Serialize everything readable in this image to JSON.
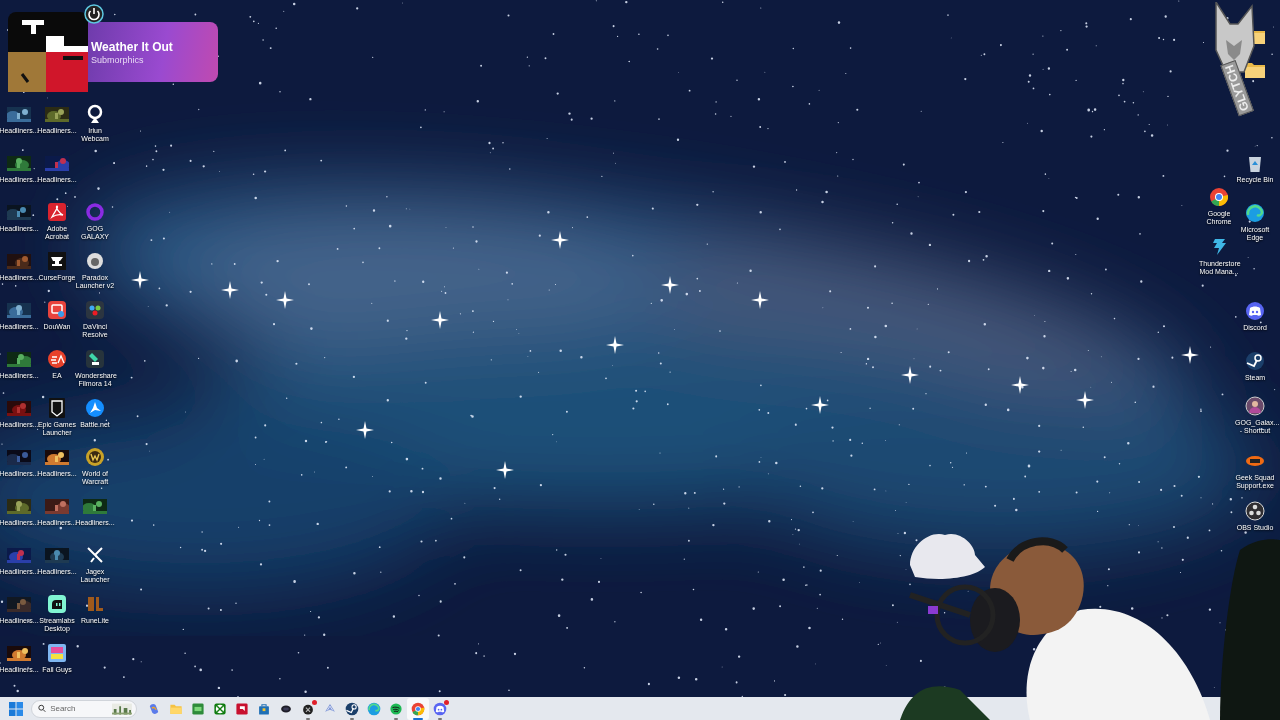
{
  "now_playing": {
    "title": "Weather It Out",
    "artist": "Submorphics"
  },
  "desktop_left": [
    [
      {
        "kind": "thumbnail",
        "label": "Headliners..."
      },
      {
        "kind": "thumbnail",
        "label": "Headliners..."
      },
      {
        "kind": "webcam",
        "label": "Iriun Webcam"
      }
    ],
    [
      {
        "kind": "thumbnail",
        "label": "Headliners..."
      },
      {
        "kind": "thumbnail",
        "label": "Headliners..."
      }
    ],
    [
      {
        "kind": "thumbnail",
        "label": "Headliners..."
      },
      {
        "kind": "pdf",
        "label": "Adobe Acrobat"
      },
      {
        "kind": "ring",
        "label": "GOG GALAXY"
      }
    ],
    [
      {
        "kind": "thumbnail",
        "label": "Headliners..."
      },
      {
        "kind": "anvil",
        "label": "CurseForge"
      },
      {
        "kind": "lion",
        "label": "Paradox Launcher v2"
      }
    ],
    [
      {
        "kind": "thumbnail",
        "label": "Headliners..."
      },
      {
        "kind": "screen",
        "label": "DouWan"
      },
      {
        "kind": "resolve",
        "label": "DaVinci Resolve"
      }
    ],
    [
      {
        "kind": "thumbnail",
        "label": "Headliners..."
      },
      {
        "kind": "ea",
        "label": "EA"
      },
      {
        "kind": "filmora",
        "label": "Wondershare Filmora 14"
      }
    ],
    [
      {
        "kind": "thumbnail",
        "label": "Headliners..."
      },
      {
        "kind": "epic",
        "label": "Epic Games Launcher"
      },
      {
        "kind": "battlenet",
        "label": "Battle.net"
      }
    ],
    [
      {
        "kind": "thumbnail",
        "label": "Headliners..."
      },
      {
        "kind": "thumbnail",
        "label": "Headliners..."
      },
      {
        "kind": "wow",
        "label": "World of Warcraft"
      }
    ],
    [
      {
        "kind": "thumbnail",
        "label": "Headliners..."
      },
      {
        "kind": "thumbnail",
        "label": "Headliners..."
      },
      {
        "kind": "thumbnail",
        "label": "Headliners..."
      }
    ],
    [
      {
        "kind": "thumbnail",
        "label": "Headliners..."
      },
      {
        "kind": "thumbnail",
        "label": "Headliners..."
      },
      {
        "kind": "jagex",
        "label": "Jagex Launcher"
      }
    ],
    [
      {
        "kind": "thumbnail",
        "label": "Headliners..."
      },
      {
        "kind": "streamlabs",
        "label": "Streamlabs Desktop"
      },
      {
        "kind": "runelite",
        "label": "RuneLite"
      }
    ],
    [
      {
        "kind": "thumbnail",
        "label": "Headliners..."
      },
      {
        "kind": "fallguys",
        "label": "Fall Guys"
      }
    ]
  ],
  "desktop_right": [
    {
      "kind": "recycle",
      "label": "Recycle Bin"
    },
    {
      "kind": "chrome",
      "label": "Google Chrome"
    },
    {
      "kind": "edge",
      "label": "Microsoft Edge"
    },
    {
      "kind": "thunderstore",
      "label": "Thunderstore Mod Mana..."
    },
    {
      "kind": "discord",
      "label": "Discord"
    },
    {
      "kind": "steam",
      "label": "Steam"
    },
    {
      "kind": "avatar",
      "label": "GOG_Galax... - Shortcut"
    },
    {
      "kind": "geeksquad",
      "label": "Geek Squad Support.exe"
    },
    {
      "kind": "obs",
      "label": "OBS Studio"
    }
  ],
  "stream_logo": {
    "text": "GLYTCH"
  },
  "taskbar": {
    "search": {
      "placeholder": "Search"
    },
    "apps": [
      {
        "kind": "copilot",
        "running": false,
        "selected": false,
        "badge": false
      },
      {
        "kind": "folder",
        "running": false,
        "selected": false,
        "badge": false
      },
      {
        "kind": "greenapp",
        "running": false,
        "selected": false,
        "badge": false
      },
      {
        "kind": "xbox",
        "running": false,
        "selected": false,
        "badge": false
      },
      {
        "kind": "redapp",
        "running": false,
        "selected": false,
        "badge": false
      },
      {
        "kind": "store",
        "running": false,
        "selected": false,
        "badge": false
      },
      {
        "kind": "oval",
        "running": false,
        "selected": false,
        "badge": false
      },
      {
        "kind": "blackapp",
        "running": true,
        "selected": false,
        "badge": true
      },
      {
        "kind": "ribbon",
        "running": false,
        "selected": false,
        "badge": false
      },
      {
        "kind": "steam",
        "running": true,
        "selected": false,
        "badge": false
      },
      {
        "kind": "edge",
        "running": false,
        "selected": false,
        "badge": false
      },
      {
        "kind": "spotify",
        "running": true,
        "selected": false,
        "badge": false
      },
      {
        "kind": "chrome",
        "running": true,
        "selected": true,
        "badge": false
      },
      {
        "kind": "discord",
        "running": true,
        "selected": false,
        "badge": true
      }
    ]
  }
}
